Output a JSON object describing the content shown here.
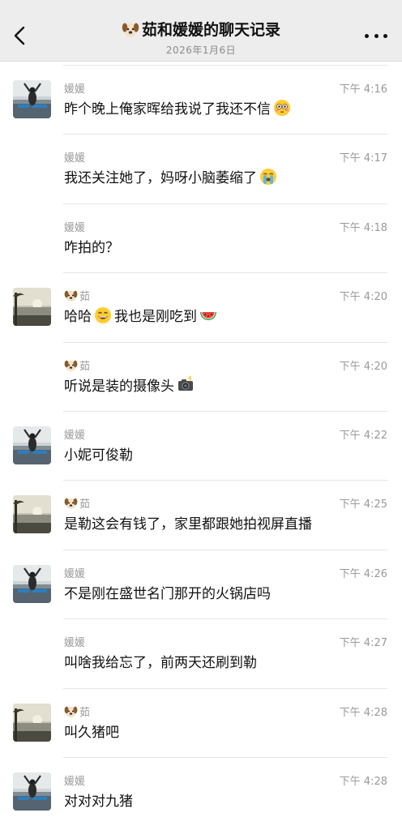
{
  "header": {
    "title": "茹和媛媛的聊天记录",
    "date": "2026年1月6日",
    "title_icon": "dog-face-icon",
    "back_icon": "chevron-left-icon",
    "more_icon": "more-dots-icon"
  },
  "messages": [
    {
      "sender": "媛媛",
      "time": "下午 4:16",
      "text": "昨个晚上俺家晖给我说了我还不信",
      "emoji": "flushed-face-icon",
      "avatar": "photo-arms-up",
      "show_avatar": true
    },
    {
      "sender": "媛媛",
      "time": "下午 4:17",
      "text": "我还关注她了，妈呀小脑萎缩了",
      "emoji": "crying-face-icon",
      "avatar": "",
      "show_avatar": false
    },
    {
      "sender": "媛媛",
      "time": "下午 4:18",
      "text": "咋拍的？",
      "emoji": "",
      "avatar": "",
      "show_avatar": false
    },
    {
      "sender": "茹",
      "time": "下午 4:20",
      "text": "哈哈",
      "text2": "我也是刚吃到",
      "emoji": "grinning-face-icon",
      "emoji2": "watermelon-icon",
      "avatar": "photo-sunset",
      "show_avatar": true
    },
    {
      "sender": "茹",
      "time": "下午 4:20",
      "text": "听说是装的摄像头",
      "emoji": "camera-flash-icon",
      "avatar": "",
      "show_avatar": false
    },
    {
      "sender": "媛媛",
      "time": "下午 4:22",
      "text": "小妮可俊勒",
      "emoji": "",
      "avatar": "photo-arms-up",
      "show_avatar": true
    },
    {
      "sender": "茹",
      "time": "下午 4:25",
      "text": "是勒这会有钱了，家里都跟她拍视屏直播",
      "emoji": "",
      "avatar": "photo-sunset",
      "show_avatar": true
    },
    {
      "sender": "媛媛",
      "time": "下午 4:26",
      "text": "不是刚在盛世名门那开的火锅店吗",
      "emoji": "",
      "avatar": "photo-arms-up",
      "show_avatar": true
    },
    {
      "sender": "媛媛",
      "time": "下午 4:27",
      "text": "叫啥我给忘了，前两天还刷到勒",
      "emoji": "",
      "avatar": "",
      "show_avatar": false
    },
    {
      "sender": "茹",
      "time": "下午 4:28",
      "text": "叫久猪吧",
      "emoji": "",
      "avatar": "photo-sunset",
      "show_avatar": true
    },
    {
      "sender": "媛媛",
      "time": "下午 4:28",
      "text": "对对对九猪",
      "emoji": "",
      "avatar": "photo-arms-up",
      "show_avatar": true
    }
  ],
  "colors": {
    "header_bg": "#ededed",
    "timestamp": "#9a9a9a",
    "divider": "#e4e4e4"
  }
}
